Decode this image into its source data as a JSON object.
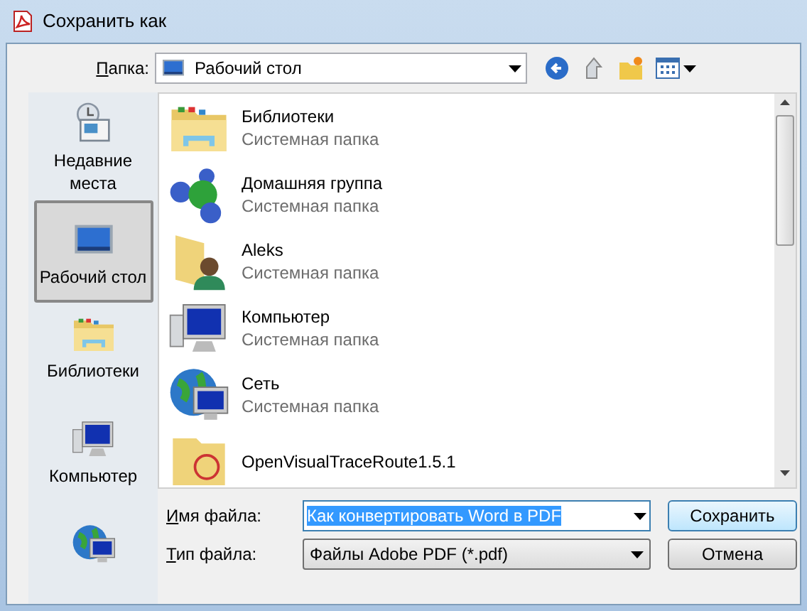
{
  "window": {
    "title": "Сохранить как"
  },
  "location": {
    "label": "Папка:",
    "value": "Рабочий стол"
  },
  "sidebar": {
    "items": [
      {
        "kind": "recent",
        "label": "Недавние\nместа",
        "selected": false
      },
      {
        "kind": "desktop",
        "label": "Рабочий стол",
        "selected": true
      },
      {
        "kind": "libraries",
        "label": "Библиотеки",
        "selected": false
      },
      {
        "kind": "computer",
        "label": "Компьютер",
        "selected": false
      },
      {
        "kind": "network",
        "selected": false
      }
    ]
  },
  "files": [
    {
      "kind": "libraries",
      "name": "Библиотеки",
      "type": "Системная папка"
    },
    {
      "kind": "homegroup",
      "name": "Домашняя группа",
      "type": "Системная папка"
    },
    {
      "kind": "user",
      "name": "Aleks",
      "type": "Системная папка"
    },
    {
      "kind": "computer",
      "name": "Компьютер",
      "type": "Системная папка"
    },
    {
      "kind": "network",
      "name": "Сеть",
      "type": "Системная папка"
    },
    {
      "kind": "folder",
      "name": "OpenVisualTraceRoute1.5.1"
    }
  ],
  "filename": {
    "label": "Имя файла:",
    "value": "Как конвертировать Word в PDF",
    "text_selected": true
  },
  "filetype": {
    "label": "Тип файла:",
    "value": "Файлы Adobe PDF (*.pdf)"
  },
  "buttons": [
    {
      "label": "Сохранить",
      "default": true
    },
    {
      "label": "Отмена",
      "default": false
    }
  ]
}
